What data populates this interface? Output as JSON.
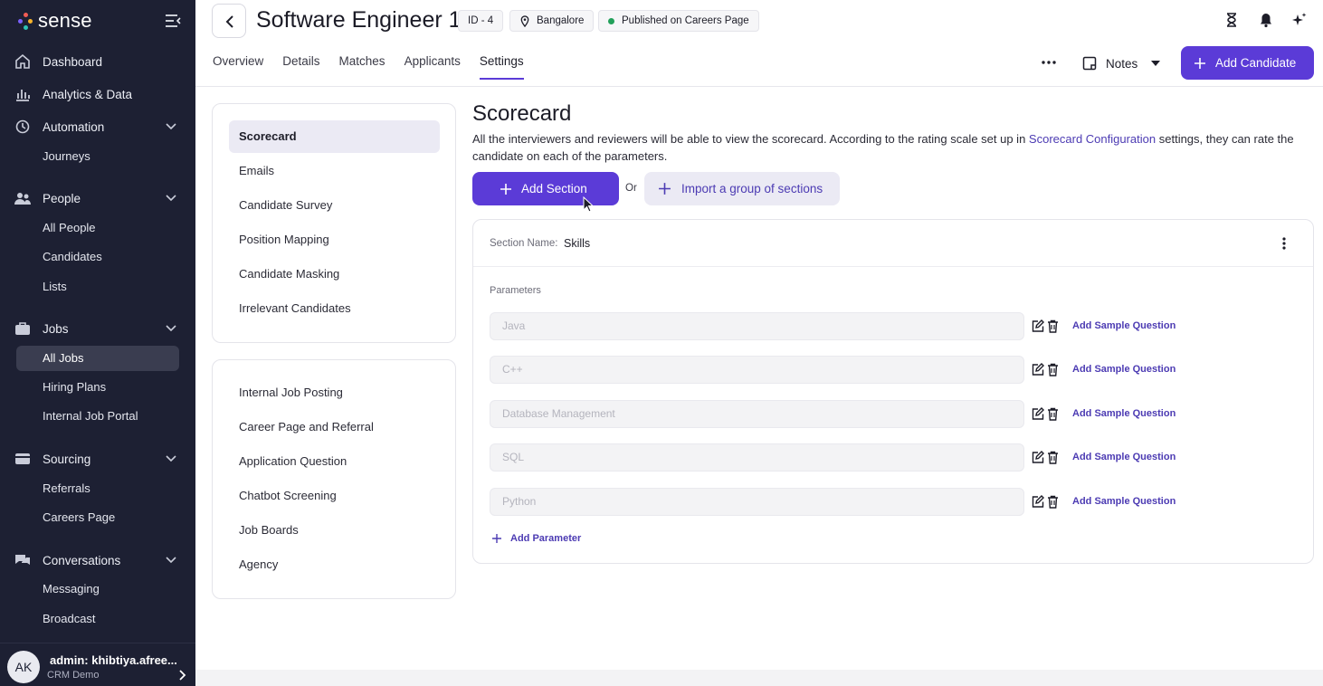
{
  "sidebar": {
    "brand": "sense",
    "nav": [
      {
        "label": "Dashboard",
        "icon": "home-icon"
      },
      {
        "label": "Analytics & Data",
        "icon": "bar-chart-icon"
      },
      {
        "label": "Automation",
        "icon": "automation-icon",
        "children": [
          "Journeys"
        ]
      },
      {
        "label": "People",
        "icon": "people-icon",
        "children": [
          "All People",
          "Candidates",
          "Lists"
        ]
      },
      {
        "label": "Jobs",
        "icon": "briefcase-icon",
        "children": [
          "All Jobs",
          "Hiring Plans",
          "Internal Job Portal"
        ],
        "active_child": "All Jobs"
      },
      {
        "label": "Sourcing",
        "icon": "sourcing-icon",
        "children": [
          "Referrals",
          "Careers Page"
        ]
      },
      {
        "label": "Conversations",
        "icon": "chat-icon",
        "children": [
          "Messaging",
          "Broadcast"
        ]
      }
    ],
    "profile": {
      "initials": "AK",
      "name": "admin: khibtiya.afree...",
      "org": "CRM Demo"
    }
  },
  "header": {
    "title": "Software Engineer 1",
    "job_id": "ID - 4",
    "location": "Bangalore",
    "status": "Published on Careers Page",
    "status_color": "#22a05a",
    "tabs": [
      "Overview",
      "Details",
      "Matches",
      "Applicants",
      "Settings"
    ],
    "active_tab": "Settings",
    "notes_label": "Notes",
    "add_candidate_label": "Add Candidate",
    "accent": "#5b3bd7"
  },
  "settings_menu": {
    "group1": [
      "Scorecard",
      "Emails",
      "Candidate Survey",
      "Position Mapping",
      "Candidate Masking",
      "Irrelevant Candidates"
    ],
    "active": "Scorecard",
    "group2": [
      "Internal Job Posting",
      "Career Page and Referral",
      "Application Question",
      "Chatbot Screening",
      "Job Boards",
      "Agency"
    ]
  },
  "scorecard": {
    "title": "Scorecard",
    "desc_before": "All the interviewers and reviewers will be able to view the scorecard. According to the rating scale set up in ",
    "desc_link": "Scorecard Configuration",
    "desc_after": " settings, they can rate the candidate on each of the parameters.",
    "add_section_label": "Add Section",
    "or_label": "Or",
    "import_label": "Import a group of sections",
    "section": {
      "name_label": "Section Name:",
      "name": "Skills",
      "parameters_label": "Parameters",
      "parameters": [
        "Java",
        "C++",
        "Database Management",
        "SQL",
        "Python"
      ],
      "sample_question_label": "Add Sample Question",
      "add_parameter_label": "Add Parameter"
    }
  }
}
